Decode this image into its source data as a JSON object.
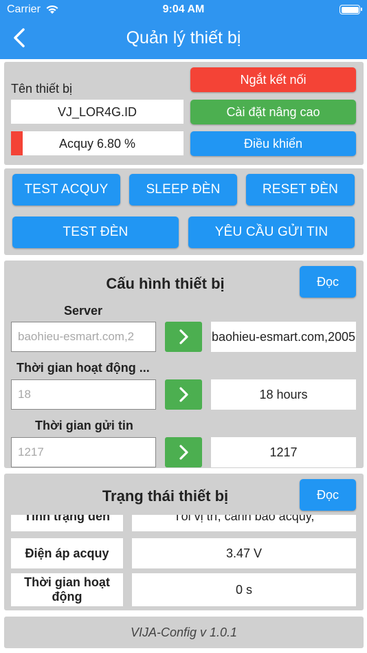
{
  "status_bar": {
    "carrier": "Carrier",
    "time": "9:04 AM"
  },
  "nav": {
    "title": "Quản lý thiết bị",
    "back_icon": "chevron-left-icon"
  },
  "device": {
    "name_label": "Tên thiết bị",
    "name_value": "VJ_LOR4G.ID",
    "battery_text": "Acquy 6.80 %",
    "battery_percent": 6.8,
    "disconnect_label": "Ngắt kết nối",
    "advanced_label": "Cài đặt nâng cao",
    "control_label": "Điều khiển"
  },
  "actions": {
    "test_battery": "TEST ACQUY",
    "sleep_light": "SLEEP ĐÈN",
    "reset_light": "RESET ĐÈN",
    "test_light": "TEST ĐÈN",
    "request_message": "YÊU CẦU GỬI TIN"
  },
  "config": {
    "title": "Cấu hình thiết bị",
    "read_label": "Đọc",
    "server": {
      "label": "Server",
      "placeholder": "baohieu-esmart.com,2",
      "value": "baohieu-esmart.com,2005"
    },
    "uptime": {
      "label": "Thời gian hoạt động ...",
      "placeholder": "18",
      "value": "18 hours"
    },
    "send_interval": {
      "label": "Thời gian gửi tin",
      "placeholder": "1217",
      "value": "1217"
    }
  },
  "device_status": {
    "title": "Trạng thái thiết bị",
    "read_label": "Đọc",
    "rows": [
      {
        "key": "Tình trạng đèn",
        "value": "Tối vị trí, cảnh báo acquy,"
      },
      {
        "key": "Điện áp acquy",
        "value": "3.47 V"
      },
      {
        "key": "Thời gian hoạt động",
        "value": "0 s"
      }
    ]
  },
  "footer": {
    "version": "VIJA-Config v 1.0.1"
  },
  "colors": {
    "primary": "#2f95f0",
    "danger": "#f44336",
    "success": "#4caf50",
    "panel": "#d0d0d0"
  }
}
